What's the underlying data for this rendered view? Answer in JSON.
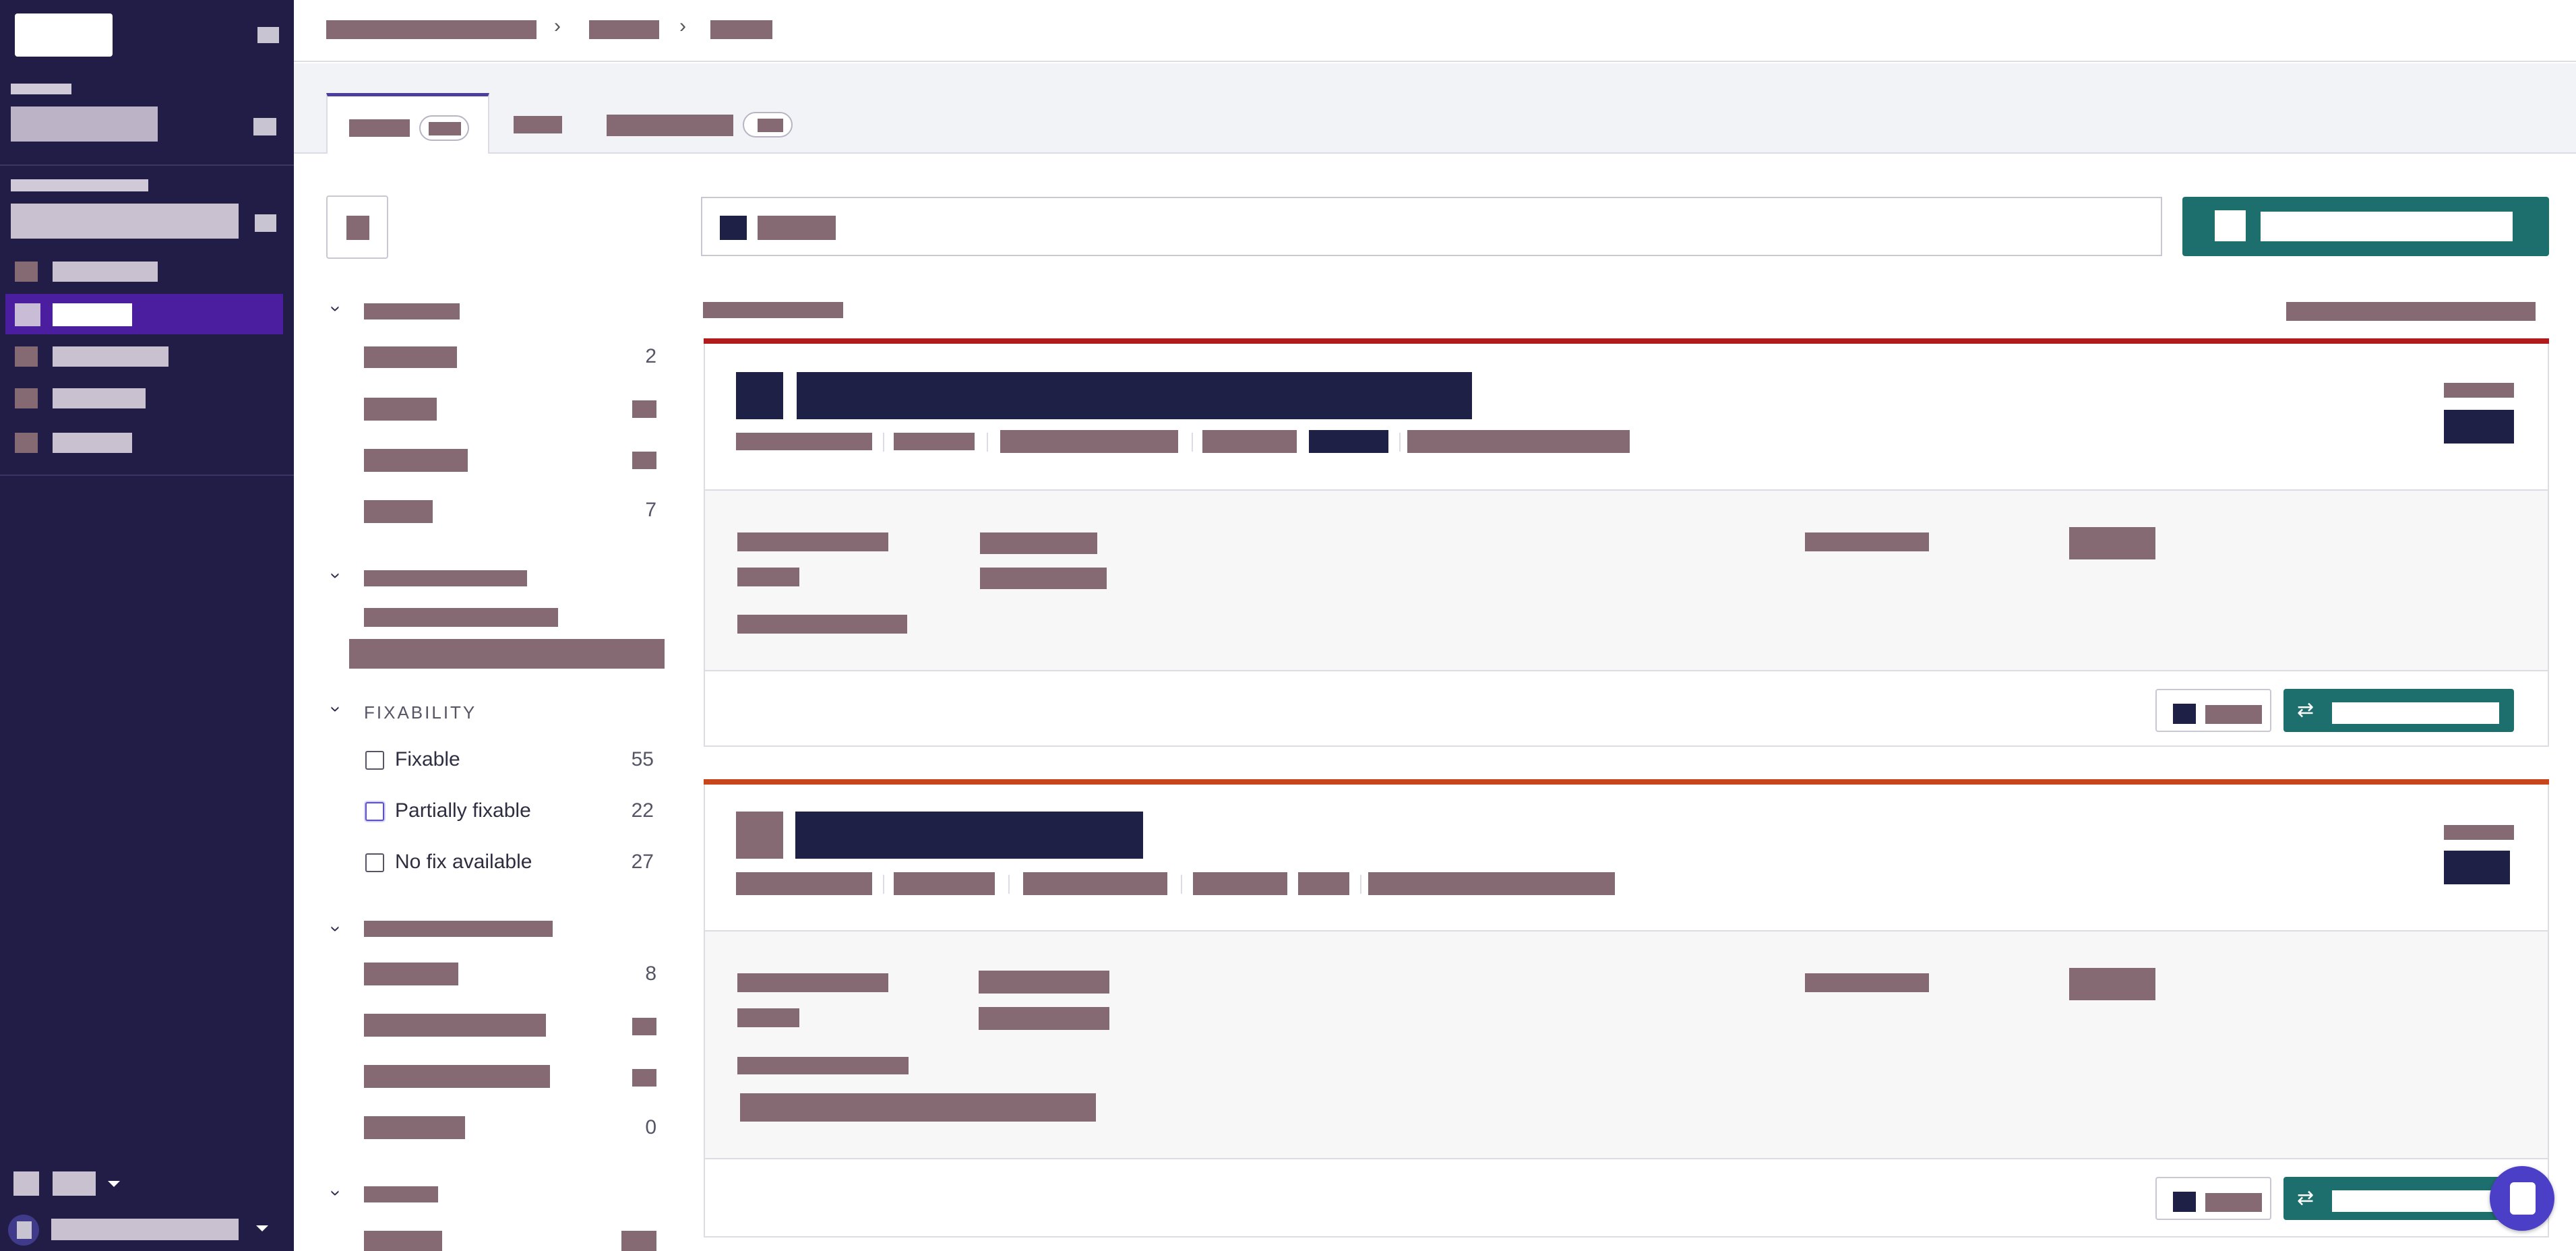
{
  "filters": {
    "fixability": {
      "title": "FIXABILITY",
      "options": [
        {
          "label": "Fixable",
          "count": "55"
        },
        {
          "label": "Partially fixable",
          "count": "22"
        },
        {
          "label": "No fix available",
          "count": "27"
        }
      ]
    },
    "group1_counts": [
      "2",
      "7"
    ],
    "group4_counts": [
      "8",
      "0"
    ]
  },
  "colors": {
    "sidebar_bg": "#211d46",
    "nav_active": "#4a1e9e",
    "primary_action": "#1d6f6e",
    "severity_critical": "#b01c1c",
    "severity_high": "#c9461c",
    "dark_text": "#1f2046"
  },
  "icons": {
    "breadcrumb_separator": "›",
    "group_toggle": "›",
    "fix_pr": "⇄"
  }
}
